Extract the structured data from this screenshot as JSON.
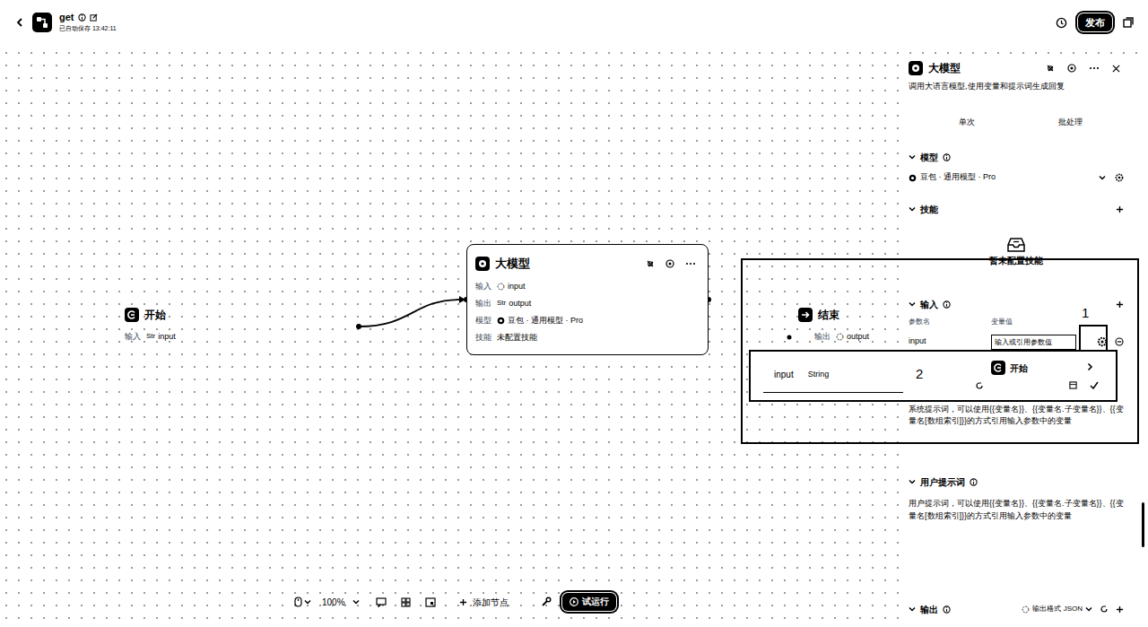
{
  "header": {
    "title": "get",
    "saved": "已自动保存 13:42:11",
    "publish": "发布"
  },
  "canvas": {
    "start": {
      "title": "开始",
      "rows": [
        {
          "label": "输入",
          "type": "Str",
          "value": "input",
          "kind": "typed"
        }
      ]
    },
    "llm": {
      "title": "大模型",
      "rows": [
        {
          "label": "输入",
          "value": "input",
          "kind": "ref"
        },
        {
          "label": "输出",
          "type": "Str",
          "value": "output",
          "kind": "typed"
        },
        {
          "label": "模型",
          "value": "豆包 · 通用模型 · Pro",
          "kind": "model"
        },
        {
          "label": "技能",
          "value": "未配置技能",
          "kind": "plain"
        }
      ]
    },
    "end": {
      "title": "结束",
      "rows": [
        {
          "label": "输出",
          "value": "output",
          "kind": "ref"
        }
      ]
    }
  },
  "panel": {
    "title": "大模型",
    "description": "调用大语言模型,使用变量和提示词生成回复",
    "tabs": [
      "单次",
      "批处理"
    ],
    "model": {
      "heading": "模型",
      "value": "豆包 · 通用模型 · Pro"
    },
    "skills": {
      "heading": "技能",
      "empty": "暂未配置技能"
    },
    "inputs": {
      "heading": "输入",
      "columns": [
        "参数名",
        "变量值"
      ],
      "rows": [
        {
          "name": "input",
          "placeholder": "输入或引用参数值"
        }
      ]
    },
    "system_prompt": {
      "text": "系统提示词，可以使用{{变量名}}、{{变量名.子变量名}}、{{变量名[数组索引]}}的方式引用输入参数中的变量"
    },
    "user_prompt": {
      "heading": "用户提示词",
      "placeholder": "用户提示词，可以使用{{变量名}}、{{变量名.子变量名}}、{{变量名[数组索引]}}的方式引用输入参数中的变量"
    },
    "output": {
      "heading": "输出",
      "format": "输出格式 JSON"
    }
  },
  "popup": {
    "name": "input",
    "type": "String",
    "source": "开始"
  },
  "annotations": {
    "gear_marker": "1",
    "popup_marker": "2"
  },
  "toolbar": {
    "zoom": "100%",
    "add_node": "添加节点",
    "test_run": "试运行"
  }
}
